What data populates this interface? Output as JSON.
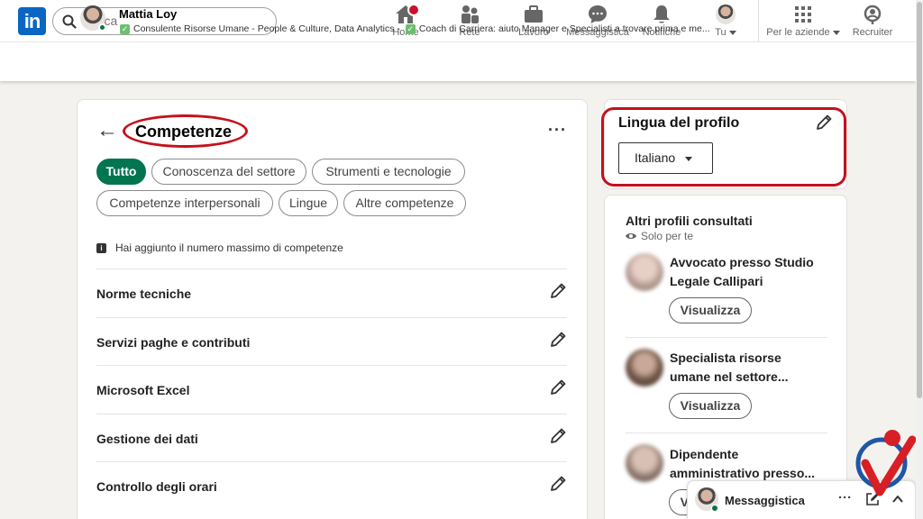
{
  "nav": {
    "logo": "in",
    "search_placeholder": "Cerca",
    "items": [
      {
        "label": "Home",
        "icon": "home-icon"
      },
      {
        "label": "Rete",
        "icon": "network-icon"
      },
      {
        "label": "Lavoro",
        "icon": "briefcase-icon"
      },
      {
        "label": "Messaggistica",
        "icon": "chat-icon"
      },
      {
        "label": "Notifiche",
        "icon": "bell-icon"
      },
      {
        "label": "Tu",
        "icon": "avatar"
      },
      {
        "label": "Per le aziende",
        "icon": "grid-icon"
      },
      {
        "label": "Recruiter",
        "icon": "recruiter-icon"
      }
    ]
  },
  "profile_strip": {
    "name": "Mattia Loy",
    "headline_1": "Consulente Risorse Umane - People & Culture, Data Analytics -",
    "headline_2": "Coach di Carriera: aiuto Manager e Specialisti a trovare prima e me..."
  },
  "skills": {
    "back_glyph": "←",
    "title": "Competenze",
    "more_glyph": "···",
    "filters": [
      "Tutto",
      "Conoscenza del settore",
      "Strumenti e tecnologie",
      "Competenze interpersonali",
      "Lingue",
      "Altre competenze"
    ],
    "notice": "Hai aggiunto il numero massimo di competenze",
    "items": [
      "Norme tecniche",
      "Servizi paghe e contributi",
      "Microsoft Excel",
      "Gestione dei dati",
      "Controllo degli orari"
    ]
  },
  "language": {
    "title": "Lingua del profilo",
    "selected": "Italiano"
  },
  "others": {
    "title": "Altri profili consultati",
    "subtitle": "Solo per te",
    "profiles": [
      {
        "name": "Avvocato presso Studio Legale Callipari",
        "button": "Visualizza"
      },
      {
        "name": "Specialista risorse umane nel settore...",
        "button": "Visualizza"
      },
      {
        "name": "Dipendente amministrativo presso...",
        "button": "Visualizza"
      }
    ]
  },
  "messaging": {
    "label": "Messaggistica",
    "dots": "···"
  },
  "colors": {
    "brand_blue": "#0a66c2",
    "active_green": "#01754f",
    "annotation_red": "#c4111c",
    "notification_red": "#cb112d"
  }
}
